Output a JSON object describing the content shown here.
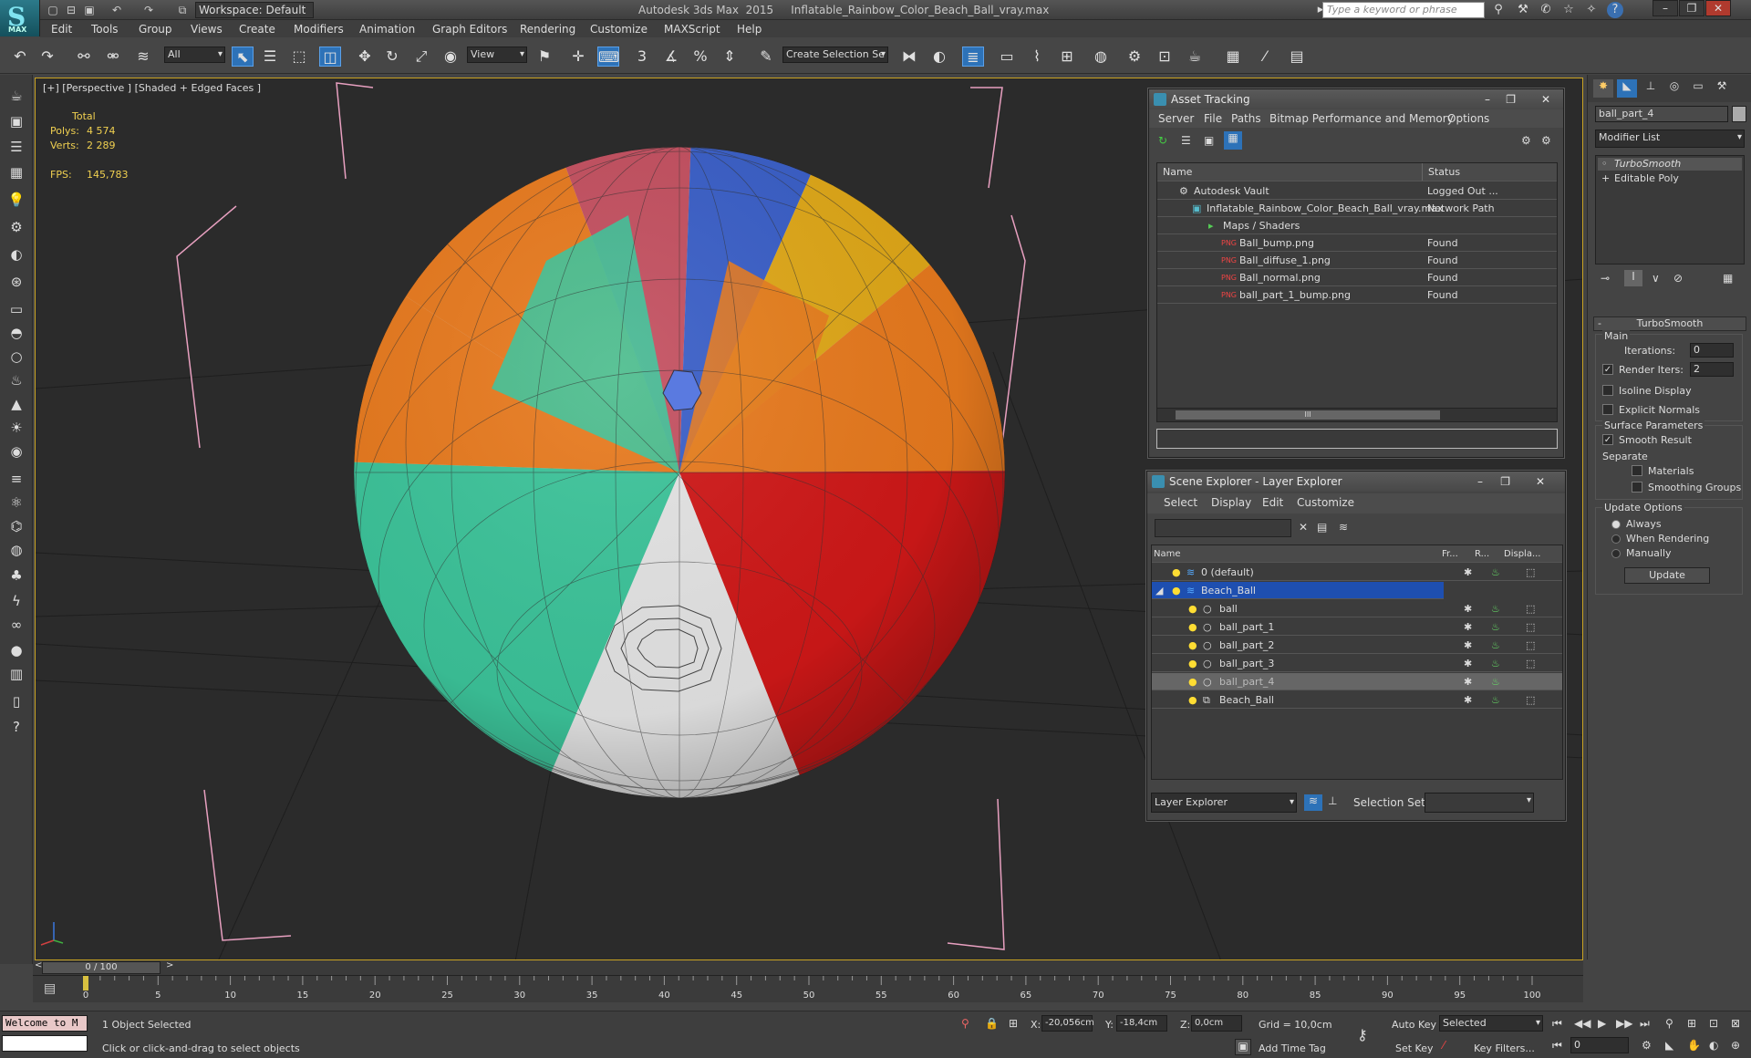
{
  "title_bar": {
    "logo_text": "MAX",
    "workspace": "Workspace: Default",
    "app_title": "Autodesk 3ds Max  2015     Inflatable_Rainbow_Color_Beach_Ball_vray.max",
    "search_placeholder": "Type a keyword or phrase",
    "help": "?"
  },
  "menu": [
    "Edit",
    "Tools",
    "Group",
    "Views",
    "Create",
    "Modifiers",
    "Animation",
    "Graph Editors",
    "Rendering",
    "Customize",
    "MAXScript",
    "Help"
  ],
  "toolbar": {
    "filter": "All",
    "ref_coord": "View",
    "selection_set": "Create Selection Se",
    "snap_3": "3",
    "snap_2_5": "2.5",
    "snap_pct": "%",
    "snap_spin": "n"
  },
  "viewport": {
    "label": "[+] [Perspective ] [Shaded + Edged Faces ]",
    "stats_header": "Total",
    "polys_label": "Polys:",
    "polys": "4 574",
    "verts_label": "Verts:",
    "verts": "2 289",
    "fps_label": "FPS:",
    "fps": "145,783"
  },
  "asset_tracking": {
    "title": "Asset Tracking",
    "menu": [
      "Server",
      "File",
      "Paths",
      "Bitmap Performance and Memory",
      "Options"
    ],
    "col_name": "Name",
    "col_status": "Status",
    "rows": [
      {
        "name": "Autodesk Vault",
        "status": "Logged Out ..."
      },
      {
        "name": "Inflatable_Rainbow_Color_Beach_Ball_vray.max",
        "status": "Network Path"
      },
      {
        "name": "Maps / Shaders",
        "status": ""
      },
      {
        "name": "Ball_bump.png",
        "status": "Found"
      },
      {
        "name": "Ball_diffuse_1.png",
        "status": "Found"
      },
      {
        "name": "Ball_normal.png",
        "status": "Found"
      },
      {
        "name": "ball_part_1_bump.png",
        "status": "Found"
      }
    ],
    "scroll_grip": "III"
  },
  "scene_explorer": {
    "title": "Scene Explorer - Layer Explorer",
    "menu": [
      "Select",
      "Display",
      "Edit",
      "Customize"
    ],
    "cols": [
      "Name",
      "Fr...",
      "R...",
      "Displa..."
    ],
    "rows": [
      "0 (default)",
      "Beach_Ball",
      "ball",
      "ball_part_1",
      "ball_part_2",
      "ball_part_3",
      "ball_part_4",
      "Beach_Ball"
    ],
    "footer_mode": "Layer Explorer",
    "selection_set_label": "Selection Set:"
  },
  "command_panel": {
    "object_name": "ball_part_4",
    "modifier_list": "Modifier List",
    "stack": [
      "TurboSmooth",
      "Editable Poly"
    ],
    "rollout_title": "TurboSmooth",
    "main_label": "Main",
    "iterations_label": "Iterations:",
    "iterations": "0",
    "render_iters_label": "Render Iters:",
    "render_iters": "2",
    "isoline": "Isoline Display",
    "explicit_normals": "Explicit Normals",
    "surface_params": "Surface Parameters",
    "smooth_result": "Smooth Result",
    "separate": "Separate",
    "materials": "Materials",
    "smoothing_groups": "Smoothing Groups",
    "update_options": "Update Options",
    "always": "Always",
    "when_rendering": "When Rendering",
    "manually": "Manually",
    "update_btn": "Update"
  },
  "timeline": {
    "slider": "0 / 100",
    "ticks": [
      "0",
      "5",
      "10",
      "15",
      "20",
      "25",
      "30",
      "35",
      "40",
      "45",
      "50",
      "55",
      "60",
      "65",
      "70",
      "75",
      "80",
      "85",
      "90",
      "95",
      "100"
    ]
  },
  "status": {
    "maxscript": "Welcome to M",
    "selected": "1 Object Selected",
    "prompt": "Click or click-and-drag to select objects",
    "x_label": "X:",
    "x": "-20,056cm",
    "y_label": "Y:",
    "y": "-18,4cm",
    "z_label": "Z:",
    "z": "0,0cm",
    "grid": "Grid = 10,0cm",
    "add_time_tag": "Add Time Tag",
    "auto_key": "Auto Key",
    "key_mode": "Selected",
    "set_key": "Set Key",
    "key_filters": "Key Filters...",
    "frame": "0"
  },
  "colors": {
    "accent": "#2d72b8",
    "viewport_border": "#c9a322",
    "stats": "#f0d050",
    "bounding_box": "#e8a0c0"
  }
}
